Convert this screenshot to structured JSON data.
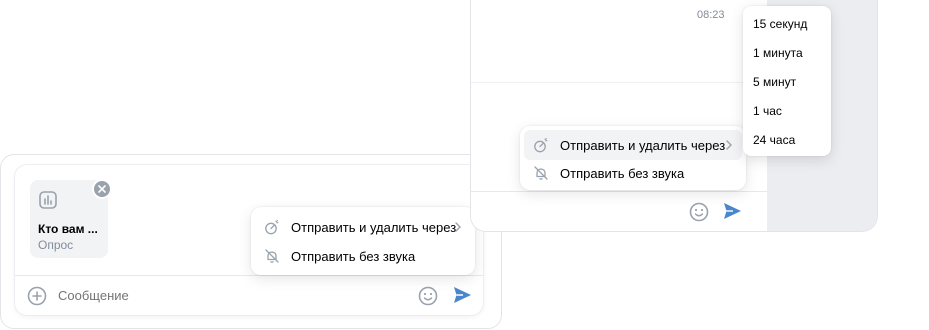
{
  "left_panel": {
    "attachment": {
      "title": "Кто вам ...",
      "subtitle": "Опрос",
      "icon": "poll-chart-icon"
    },
    "composer": {
      "placeholder": "Сообщение"
    },
    "menu": {
      "items": [
        {
          "label": "Отправить и удалить через",
          "icon": "timer-icon",
          "has_submenu": true
        },
        {
          "label": "Отправить без звука",
          "icon": "bell-off-icon",
          "has_submenu": false
        }
      ]
    }
  },
  "right_panel": {
    "time": "08:23",
    "menu": {
      "items": [
        {
          "label": "Отправить и удалить через",
          "icon": "timer-icon",
          "has_submenu": true
        },
        {
          "label": "Отправить без звука",
          "icon": "bell-off-icon",
          "has_submenu": false
        }
      ]
    },
    "submenu": {
      "items": [
        "15 секунд",
        "1 минута",
        "5 минут",
        "1 час",
        "24 часа"
      ]
    }
  },
  "colors": {
    "accent": "#4986cc",
    "icon_gray": "#99a2ad",
    "muted_text": "#818c99",
    "hover_bg": "#f2f3f5"
  }
}
